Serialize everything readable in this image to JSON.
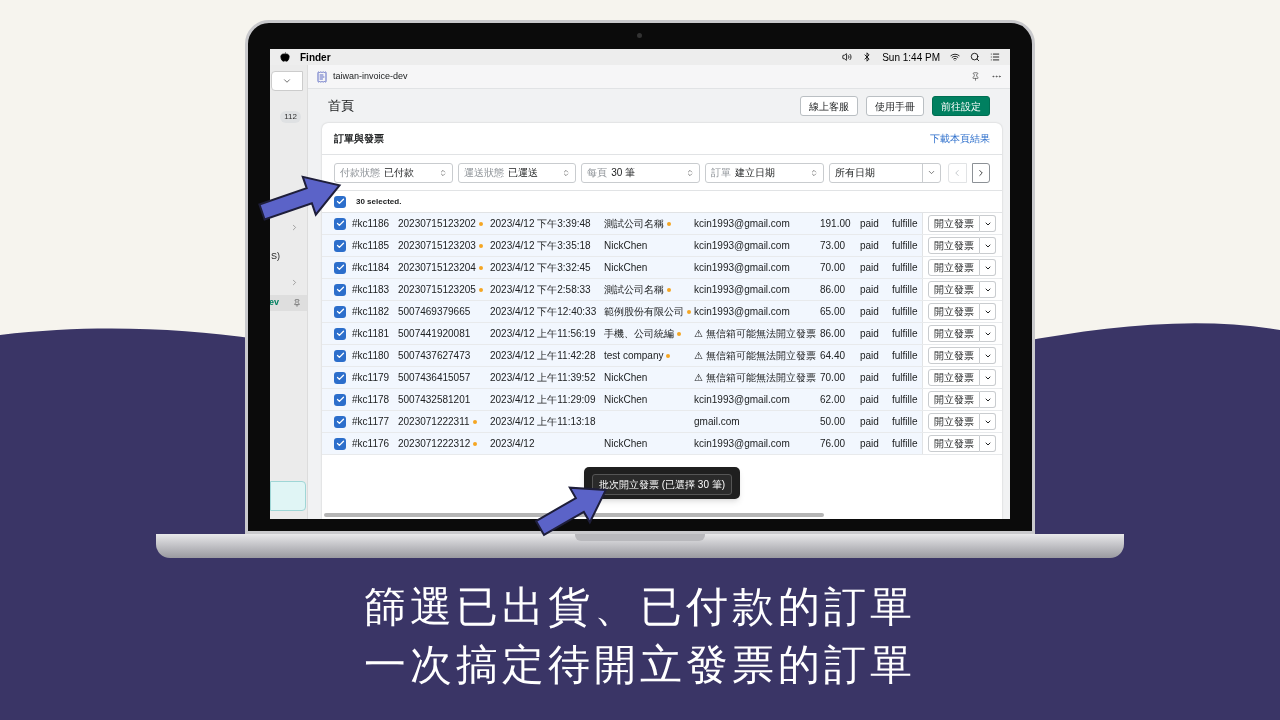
{
  "menu_bar": {
    "app": "Finder",
    "clock": "Sun 1:44 PM"
  },
  "sidebar": {
    "count_badge": "112",
    "partial_label": "S)",
    "active_item": {
      "label": "ev",
      "selected": true
    }
  },
  "app_bar": {
    "title": "taiwan-invoice-dev"
  },
  "page": {
    "title": "首頁",
    "buttons": [
      {
        "label": "線上客服",
        "primary": false
      },
      {
        "label": "使用手冊",
        "primary": false
      },
      {
        "label": "前往設定",
        "primary": true
      }
    ]
  },
  "card": {
    "title": "訂單與發票",
    "link": "下載本頁結果",
    "filters": [
      {
        "kind": "select",
        "label": "付款狀態",
        "value": "已付款"
      },
      {
        "kind": "select",
        "label": "運送狀態",
        "value": "已運送"
      },
      {
        "kind": "select",
        "label": "每頁",
        "value": "30 筆"
      },
      {
        "kind": "select",
        "label": "訂單",
        "value": "建立日期"
      },
      {
        "kind": "date",
        "value": "所有日期"
      }
    ],
    "pager": {
      "prev_disabled": true,
      "next_disabled": false
    },
    "selection": {
      "checked": true,
      "text": "30 selected."
    },
    "rows": [
      {
        "checked": true,
        "id": "#kc1186",
        "order_no": "20230715123202",
        "order_dot": true,
        "date": "2023/4/12 下午3:39:48",
        "name": "測試公司名稱",
        "name_dot": true,
        "email": "kcin1993@gmail.com",
        "amount": "191.00",
        "payment": "paid",
        "fulfillment": "fulfille",
        "action": "開立發票"
      },
      {
        "checked": true,
        "id": "#kc1185",
        "order_no": "20230715123203",
        "order_dot": true,
        "date": "2023/4/12 下午3:35:18",
        "name": "NickChen",
        "name_dot": false,
        "email": "kcin1993@gmail.com",
        "amount": "73.00",
        "payment": "paid",
        "fulfillment": "fulfille",
        "action": "開立發票"
      },
      {
        "checked": true,
        "id": "#kc1184",
        "order_no": "20230715123204",
        "order_dot": true,
        "date": "2023/4/12 下午3:32:45",
        "name": "NickChen",
        "name_dot": false,
        "email": "kcin1993@gmail.com",
        "amount": "70.00",
        "payment": "paid",
        "fulfillment": "fulfille",
        "action": "開立發票"
      },
      {
        "checked": true,
        "id": "#kc1183",
        "order_no": "20230715123205",
        "order_dot": true,
        "date": "2023/4/12 下午2:58:33",
        "name": "測試公司名稱",
        "name_dot": true,
        "email": "kcin1993@gmail.com",
        "amount": "86.00",
        "payment": "paid",
        "fulfillment": "fulfille",
        "action": "開立發票"
      },
      {
        "checked": true,
        "id": "#kc1182",
        "order_no": "5007469379665",
        "order_dot": false,
        "date": "2023/4/12 下午12:40:33",
        "name": "範例股份有限公司",
        "name_dot": true,
        "email": "kcin1993@gmail.com",
        "amount": "65.00",
        "payment": "paid",
        "fulfillment": "fulfille",
        "action": "開立發票"
      },
      {
        "checked": true,
        "id": "#kc1181",
        "order_no": "5007441920081",
        "order_dot": false,
        "date": "2023/4/12 上午11:56:19",
        "name": "手機、公司統編",
        "name_dot": true,
        "email": "⚠ 無信箱可能無法開立發票",
        "amount": "86.00",
        "payment": "paid",
        "fulfillment": "fulfille",
        "action": "開立發票"
      },
      {
        "checked": true,
        "id": "#kc1180",
        "order_no": "5007437627473",
        "order_dot": false,
        "date": "2023/4/12 上午11:42:28",
        "name": "test company",
        "name_dot": true,
        "email": "⚠ 無信箱可能無法開立發票",
        "amount": "64.40",
        "payment": "paid",
        "fulfillment": "fulfille",
        "action": "開立發票"
      },
      {
        "checked": true,
        "id": "#kc1179",
        "order_no": "5007436415057",
        "order_dot": false,
        "date": "2023/4/12 上午11:39:52",
        "name": "NickChen",
        "name_dot": false,
        "email": "⚠ 無信箱可能無法開立發票",
        "amount": "70.00",
        "payment": "paid",
        "fulfillment": "fulfille",
        "action": "開立發票"
      },
      {
        "checked": true,
        "id": "#kc1178",
        "order_no": "5007432581201",
        "order_dot": false,
        "date": "2023/4/12 上午11:29:09",
        "name": "NickChen",
        "name_dot": false,
        "email": "kcin1993@gmail.com",
        "amount": "62.00",
        "payment": "paid",
        "fulfillment": "fulfille",
        "action": "開立發票"
      },
      {
        "checked": true,
        "id": "#kc1177",
        "order_no": "2023071222311",
        "order_dot": true,
        "date": "2023/4/12 上午11:13:18",
        "name_dot": false,
        "email": "gmail.com",
        "amount": "50.00",
        "payment": "paid",
        "fulfillment": "fulfille",
        "action": "開立發票"
      },
      {
        "checked": true,
        "id": "#kc1176",
        "order_no": "2023071222312",
        "order_dot": true,
        "date": "2023/4/12",
        "name": "NickChen",
        "name_dot": false,
        "email": "kcin1993@gmail.com",
        "amount": "76.00",
        "payment": "paid",
        "fulfillment": "fulfille",
        "action": "開立發票"
      }
    ],
    "bulk_action": "批次開立發票 (已選擇 30 筆)"
  },
  "caption": [
    "篩選已出貨、已付款的訂單",
    "一次搞定待開立發票的訂單"
  ]
}
